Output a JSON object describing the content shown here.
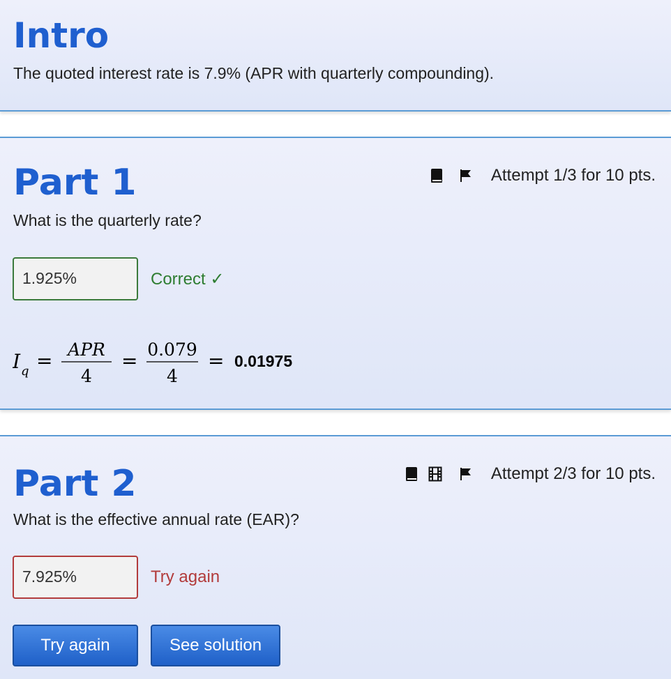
{
  "intro": {
    "title": "Intro",
    "text": "The quoted interest rate is 7.9% (APR with quarterly compounding)."
  },
  "part1": {
    "title": "Part 1",
    "question": "What is the quarterly rate?",
    "attempt": "Attempt 1/3 for 10 pts.",
    "icons": [
      "book-icon",
      "flag-icon"
    ],
    "answer_value": "1.925%",
    "feedback": "Correct ✓",
    "feedback_color": "#2e7d32",
    "formula": {
      "lhs_symbol": "I",
      "lhs_subscript": "q",
      "frac1_num": "APR",
      "frac1_den": "4",
      "frac2_num": "0.079",
      "frac2_den": "4",
      "result": "0.01975"
    }
  },
  "part2": {
    "title": "Part 2",
    "question": "What is the effective annual rate (EAR)?",
    "attempt": "Attempt 2/3 for 10 pts.",
    "icons": [
      "book-icon",
      "video-icon",
      "flag-icon"
    ],
    "answer_value": "7.925%",
    "feedback": "Try again",
    "feedback_color": "#b23b3b",
    "buttons": {
      "try_again": "Try again",
      "see_solution": "See solution"
    }
  },
  "colors": {
    "title_blue": "#1f5fcf",
    "card_border": "#5b9bd5",
    "button_blue": "#2a6fd6"
  }
}
